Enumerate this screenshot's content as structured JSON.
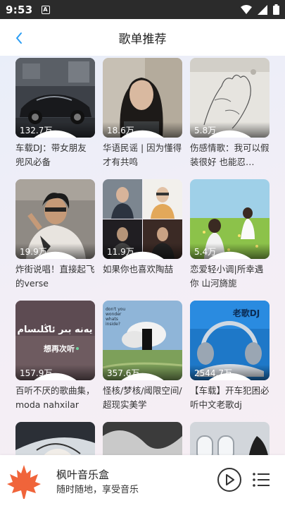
{
  "status_bar": {
    "time": "9:53",
    "notification_icon": "A"
  },
  "header": {
    "title": "歌单推荐",
    "back_icon": "chevron-left-icon",
    "accent": "#2a9df4"
  },
  "playlists": [
    {
      "title": "车载DJ：带女朋友兜风必备",
      "plays": "132.7万"
    },
    {
      "title": "华语民谣 | 因为懂得才有共鸣",
      "plays": "18.6万"
    },
    {
      "title": "伤感情歌：我可以假装很好 也能忍…",
      "plays": "5.8万"
    },
    {
      "title": "炸街说唱！直接起飞的verse",
      "plays": "19.9万"
    },
    {
      "title": "如果你也喜欢陶喆",
      "plays": "11.9万"
    },
    {
      "title": "恋爱轻小调|所幸遇你 山河旖旎",
      "plays": "5.4万"
    },
    {
      "title": "百听不厌的歌曲集，moda nahxilar",
      "plays": "157.9万"
    },
    {
      "title": "怪核/梦核/阈限空间/超现实美学",
      "plays": "357.6万"
    },
    {
      "title": "【车载】开车犯困必听中文老歌dj",
      "plays": "2544.7万"
    },
    {
      "title": "",
      "plays": ""
    },
    {
      "title": "",
      "plays": ""
    },
    {
      "title": "",
      "plays": ""
    }
  ],
  "cover_text": {
    "uyghur_line": "يەنە بىر ئاڭلىسام",
    "chinese_line": "想再次听",
    "question": [
      "don't you",
      "wonder",
      "whats",
      "inside?"
    ],
    "dj_label": "老歌DJ"
  },
  "player": {
    "title": "枫叶音乐盒",
    "subtitle": "随时随地，享受音乐",
    "logo_color": "#f0643a"
  }
}
